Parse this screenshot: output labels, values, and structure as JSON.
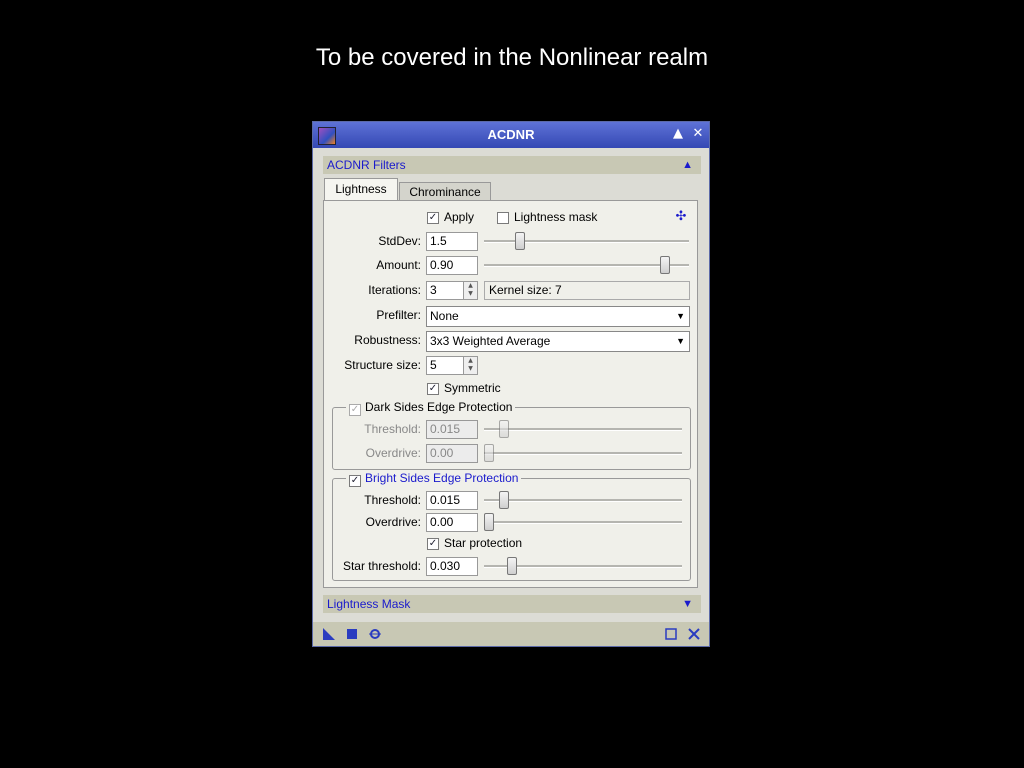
{
  "slide": {
    "title": "To be covered in the Nonlinear realm"
  },
  "window": {
    "title": "ACDNR"
  },
  "sections": {
    "filters": "ACDNR Filters",
    "mask": "Lightness Mask"
  },
  "tabs": [
    "Lightness",
    "Chrominance"
  ],
  "form": {
    "apply_label": "Apply",
    "lightness_mask_label": "Lightness mask",
    "stddev_label": "StdDev:",
    "stddev_value": "1.5",
    "stddev_level": 0.16,
    "amount_label": "Amount:",
    "amount_value": "0.90",
    "amount_level": 0.9,
    "iterations_label": "Iterations:",
    "iterations_value": "3",
    "kernel_info": "Kernel size: 7",
    "prefilter_label": "Prefilter:",
    "prefilter_value": "None",
    "robustness_label": "Robustness:",
    "robustness_value": "3x3 Weighted Average",
    "structure_label": "Structure size:",
    "structure_value": "5",
    "symmetric_label": "Symmetric",
    "dark": {
      "title": "Dark Sides Edge Protection",
      "threshold_label": "Threshold:",
      "threshold_value": "0.015",
      "threshold_level": 0.08,
      "overdrive_label": "Overdrive:",
      "overdrive_value": "0.00",
      "overdrive_level": 0.0
    },
    "bright": {
      "title": "Bright Sides Edge Protection",
      "threshold_label": "Threshold:",
      "threshold_value": "0.015",
      "threshold_level": 0.08,
      "overdrive_label": "Overdrive:",
      "overdrive_value": "0.00",
      "overdrive_level": 0.0,
      "star_protection_label": "Star protection",
      "star_threshold_label": "Star threshold:",
      "star_threshold_value": "0.030",
      "star_threshold_level": 0.12
    }
  },
  "colors": {
    "titlebar": "#4a5ec8",
    "section_text": "#1a1acc",
    "background": "#000000"
  }
}
